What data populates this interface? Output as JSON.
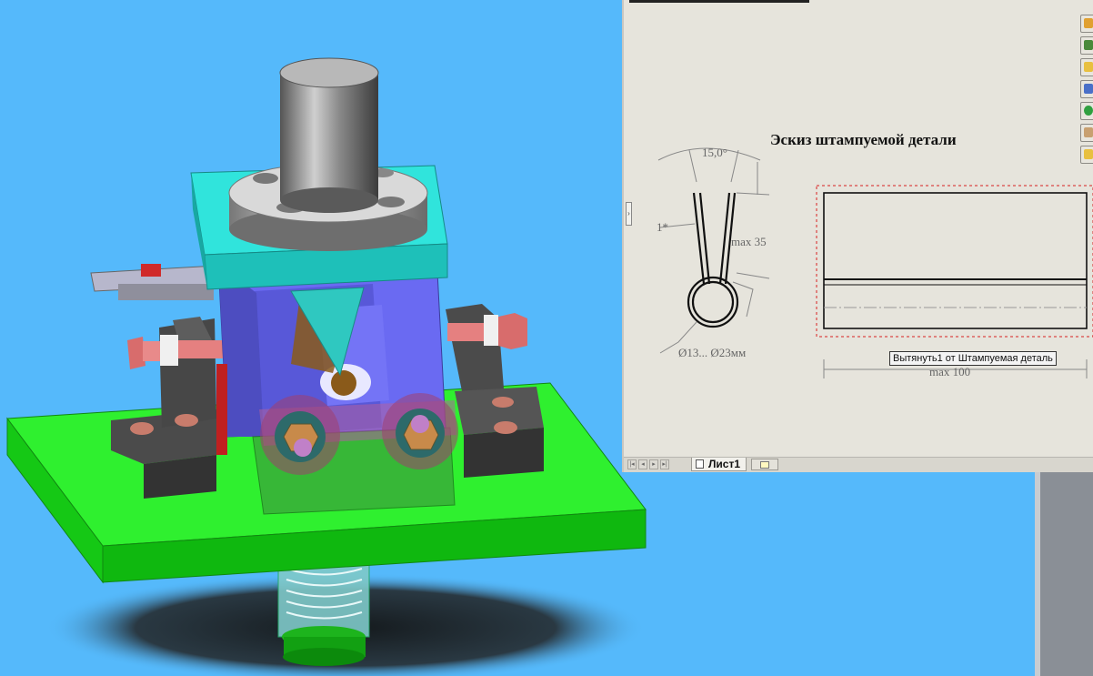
{
  "drawing": {
    "title": "Эскиз штампуемой детали",
    "angle_label": "15,0°",
    "radius_label": "1*",
    "height_label": "max 35",
    "diameter_label": "Ø13... Ø23мм",
    "tooltip": "Вытянуть1 от Штампуемая деталь",
    "length_label": "max 100"
  },
  "sheet_tabs": {
    "active_tab": "Лист1"
  },
  "task_pane": {
    "icons": [
      "home-icon",
      "parts-library-icon",
      "folder-icon",
      "view-palette-icon",
      "appearances-icon",
      "custom-properties-icon",
      "search-folder-icon"
    ]
  },
  "colors": {
    "background": "#55b9fb",
    "base_plate": "#25e625",
    "clamp_plate": "#2fe0d8",
    "die_block": "#6767f0",
    "drawing_sheet": "#e6e4dc"
  }
}
